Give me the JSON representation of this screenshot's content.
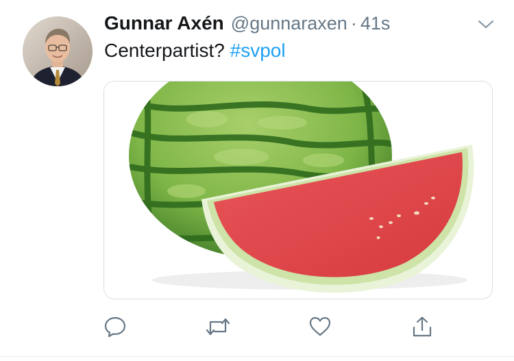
{
  "tweet": {
    "author_name": "Gunnar Axén",
    "author_handle": "@gunnaraxen",
    "separator": "·",
    "timestamp": "41s",
    "text_prefix": "Centerpartist? ",
    "hashtag": "#svpol"
  },
  "colors": {
    "hashtag": "#1da1f2",
    "muted": "#657786",
    "text": "#14171a"
  },
  "icons": {
    "menu": "chevron-down-icon",
    "reply": "reply-icon",
    "retweet": "retweet-icon",
    "like": "heart-icon",
    "share": "share-icon"
  }
}
